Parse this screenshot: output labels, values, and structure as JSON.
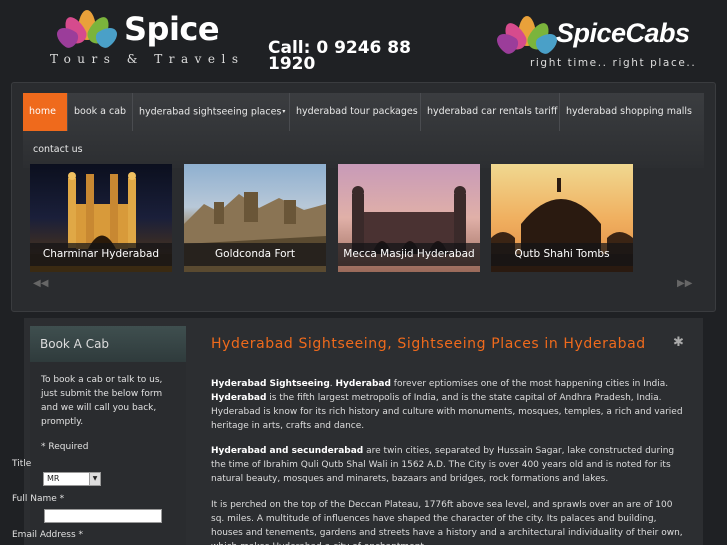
{
  "header": {
    "brand_left": "Spice",
    "brand_left_sub": "Tours & Travels",
    "call_text": "Call: 0 9246 88 1920",
    "brand_right": "SpiceCabs",
    "tagline": "right time.. right place.."
  },
  "nav": {
    "items": [
      {
        "label": "home",
        "active": true
      },
      {
        "label": "book a cab"
      },
      {
        "label": "hyderabad sightseeing places"
      },
      {
        "label": "hyderabad tour packages"
      },
      {
        "label": "hyderabad car rentals tariff"
      },
      {
        "label": "hyderabad shopping malls"
      },
      {
        "label": "contact us"
      }
    ],
    "dropdown_caret": "▾"
  },
  "slider": {
    "slides": [
      {
        "caption": "Charminar Hyderabad"
      },
      {
        "caption": "Goldconda Fort"
      },
      {
        "caption": "Mecca Masjid Hyderabad"
      },
      {
        "caption": "Qutb Shahi Tombs"
      }
    ],
    "prev_icon": "◀◀",
    "next_icon": "▶▶"
  },
  "sidebar": {
    "title": "Book A Cab",
    "intro": "To book a cab or talk to us, just submit the below form and we will call you back, promptly.",
    "required_note": "* Required",
    "title_label": "Title",
    "title_value": "MR",
    "fullname_label": "Full Name *",
    "email_label": "Email Address *"
  },
  "main": {
    "heading": "Hyderabad Sightseeing, Sightseeing Places in Hyderabad",
    "p1_b1": "Hyderabad Sightseeing",
    "p1_sep": ". ",
    "p1_b2": "Hyderabad",
    "p1_t1": " forever eptiomises one of the most happening cities in India. ",
    "p1_b3": "Hyderabad",
    "p1_t2": " is the fifth largest metropolis of India, and is the state capital of Andhra Pradesh, India. Hyderabad is know for its rich history and culture with monuments, mosques, temples, a rich and varied heritage in arts, crafts and dance.",
    "p2_b1": "Hyderabad and secunderabad",
    "p2_t1": " are twin cities, separated by Hussain Sagar, lake constructed during the time of Ibrahim Quli Qutb Shal Wali in 1562 A.D. The City is over 400 years old and is noted for its natural beauty, mosques and minarets, bazaars and bridges, rock formations and lakes.",
    "p3": "It is perched on the top of the Deccan Plateau, 1776ft above sea level, and sprawls over an are of 100 sq. miles. A multitude of influences have shaped the character of the city. Its palaces and building, houses and tenements, gardens and streets have a history and a architectural individuality of their own, which makes Hyderabad a city of enchantment."
  }
}
